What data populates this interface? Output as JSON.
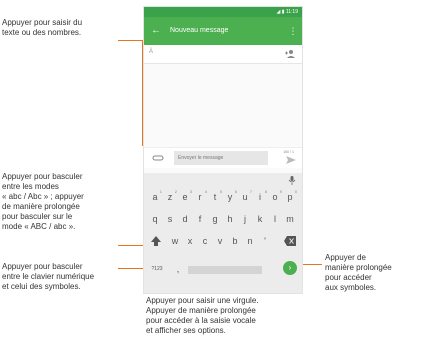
{
  "callouts": {
    "input_text": "Appuyer pour saisir du\ntexte ou des nombres.",
    "mode_switch": "Appuyer pour basculer\nentre les modes\n« abc / Abc » ; appuyer\nde manière prolongée\npour basculer sur le\nmode « ABC / abc ».",
    "keyboard_switch": "Appuyer pour basculer\nentre le clavier numérique\net celui des symboles.",
    "symbols": "Appuyer de\nmanière prolongée\npour accéder\naux symboles.",
    "comma": "Appuyer pour saisir une virgule.\nAppuyer de manière prolongée\npour accéder à la saisie vocale\net afficher ses options."
  },
  "status": {
    "time": "11:19",
    "icons": "◢ ▮"
  },
  "appbar": {
    "back": "←",
    "title": "Nouveau message",
    "menu": "⋮"
  },
  "to_field": {
    "label": "À"
  },
  "composer": {
    "placeholder": "Envoyer le message",
    "counter": "160 / 1"
  },
  "keyboard": {
    "row1": [
      {
        "k": "a",
        "n": "1"
      },
      {
        "k": "z",
        "n": "2"
      },
      {
        "k": "e",
        "n": "3"
      },
      {
        "k": "r",
        "n": "4"
      },
      {
        "k": "t",
        "n": "5"
      },
      {
        "k": "y",
        "n": "6"
      },
      {
        "k": "u",
        "n": "7"
      },
      {
        "k": "i",
        "n": "8"
      },
      {
        "k": "o",
        "n": "9"
      },
      {
        "k": "p",
        "n": "0"
      }
    ],
    "row2": [
      "q",
      "s",
      "d",
      "f",
      "g",
      "h",
      "j",
      "k",
      "l",
      "m"
    ],
    "row3": [
      "w",
      "x",
      "c",
      "v",
      "b",
      "n",
      "'"
    ],
    "symbols_key": "?123",
    "comma_key": ",",
    "enter_key": "›"
  },
  "colors": {
    "accent": "#4caf50",
    "status": "#3aa24a",
    "callout_line": "#e8761e"
  },
  "icons": [
    "back-arrow-icon",
    "overflow-menu-icon",
    "add-contact-icon",
    "attach-icon",
    "send-icon",
    "mic-icon",
    "shift-icon",
    "backspace-icon",
    "enter-icon"
  ]
}
